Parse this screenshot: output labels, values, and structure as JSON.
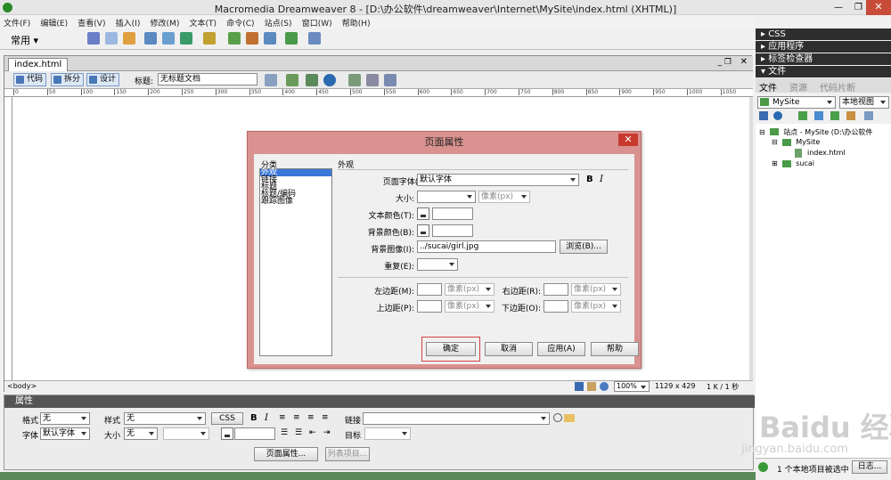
{
  "window": {
    "title": "Macromedia Dreamweaver 8 - [D:\\办公软件\\dreamweaver\\Internet\\MySite\\index.html (XHTML)]"
  },
  "menu": [
    "文件(F)",
    "编辑(E)",
    "查看(V)",
    "插入(I)",
    "修改(M)",
    "文本(T)",
    "命令(C)",
    "站点(S)",
    "窗口(W)",
    "帮助(H)"
  ],
  "insertbar": {
    "category": "常用"
  },
  "document": {
    "tab": "index.html",
    "views": {
      "code": "代码",
      "split": "拆分",
      "design": "设计"
    },
    "title_label": "标题:",
    "title_value": "无标题文档",
    "ruler_ticks": [
      "0",
      "50",
      "100",
      "150",
      "200",
      "250",
      "300",
      "350",
      "400",
      "450",
      "500",
      "550",
      "600",
      "650",
      "700",
      "750",
      "800",
      "850",
      "900",
      "950",
      "1000",
      "1050"
    ],
    "tag": "<body>",
    "zoom": "100%",
    "size": "1129 x 429",
    "download": "1 K / 1 秒"
  },
  "dialog": {
    "title": "页面属性",
    "category_label": "分类",
    "categories": [
      "外观",
      "链接",
      "标题",
      "标题/编码",
      "跟踪图像"
    ],
    "section": "外观",
    "page_font_label": "页面字体(F):",
    "page_font_value": "默认字体",
    "bold": "B",
    "italic": "I",
    "size_label": "大小:",
    "size_unit": "像素(px)",
    "text_color_label": "文本颜色(T):",
    "bg_color_label": "背景颜色(B):",
    "bg_image_label": "背景图像(I):",
    "bg_image_value": "../sucai/girl.jpg",
    "browse": "浏览(B)...",
    "repeat_label": "重复(E):",
    "left_margin_label": "左边距(M):",
    "right_margin_label": "右边距(R):",
    "top_margin_label": "上边距(P):",
    "bottom_margin_label": "下边距(O):",
    "margin_unit": "像素(px)",
    "ok": "确定",
    "cancel": "取消",
    "apply": "应用(A)",
    "help": "帮助"
  },
  "properties": {
    "header": "属性",
    "format_label": "格式",
    "format_value": "无",
    "style_label": "样式",
    "style_value": "无",
    "css": "CSS",
    "bold": "B",
    "italic": "I",
    "link_label": "链接",
    "font_label": "字体",
    "font_value": "默认字体",
    "size_label": "大小",
    "size_value": "无",
    "target_label": "目标",
    "page_props": "页面属性...",
    "list_item": "列表项目..."
  },
  "panels": {
    "css": "CSS",
    "app": "应用程序",
    "tag_inspector": "标签检查器",
    "files": "文件",
    "tabs": [
      "文件",
      "资源",
      "代码片断"
    ],
    "site": "MySite",
    "view": "本地视图",
    "tree": [
      "站点 - MySite (D:\\办公软件",
      "MySite",
      "index.html",
      "sucai"
    ]
  },
  "statusbar": {
    "text": "1 个本地项目被选中",
    "log": "日志..."
  },
  "watermark": {
    "brand": "Baidu 经验",
    "url": "jingyan.baidu.com"
  }
}
